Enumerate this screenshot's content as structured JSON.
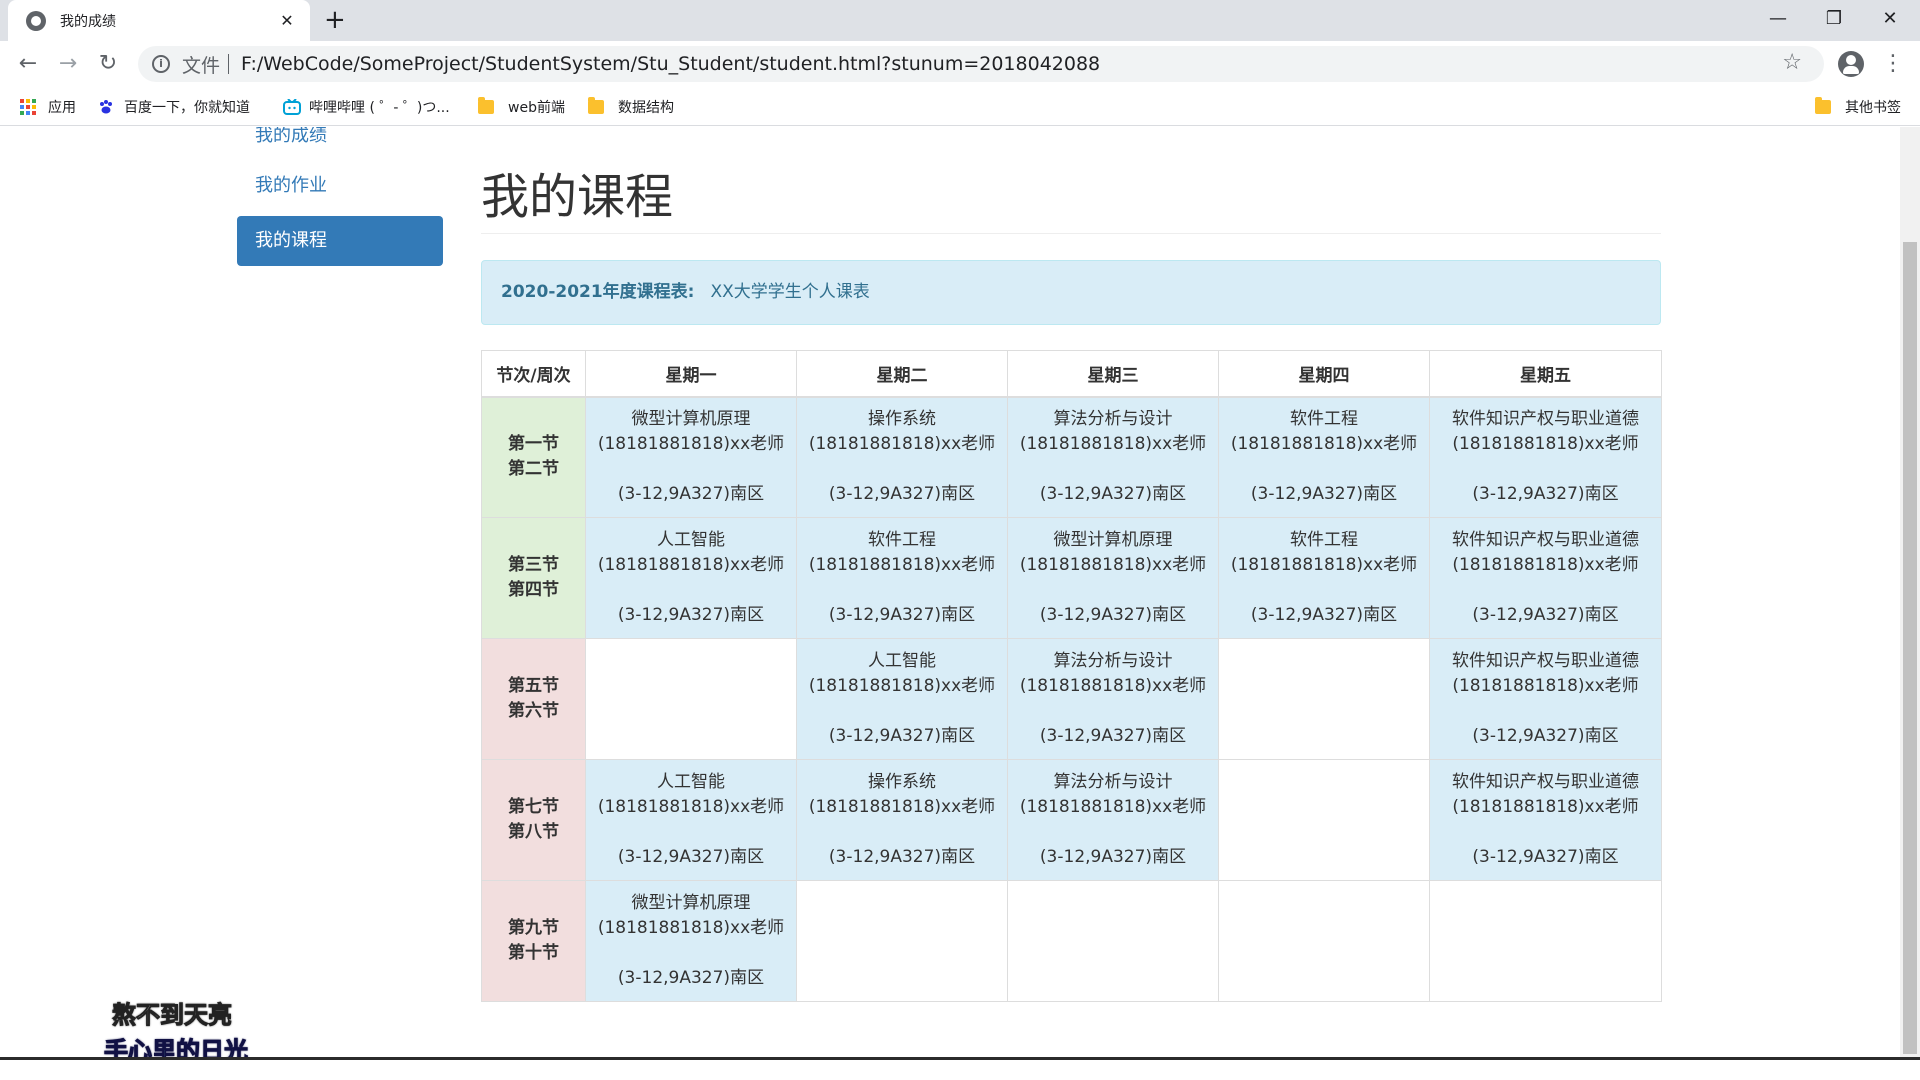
{
  "browser": {
    "tab_title": "我的成绩",
    "close_glyph": "✕",
    "new_tab_glyph": "+",
    "window_controls": {
      "minimize": "—",
      "maximize": "❐",
      "close": "✕"
    },
    "nav": {
      "back": "←",
      "forward": "→",
      "reload": "↻"
    },
    "address": {
      "info_glyph": "i",
      "scheme_label": "文件",
      "url": "F:/WebCode/SomeProject/StudentSystem/Stu_Student/student.html?stunum=2018042088"
    },
    "star_glyph": "☆",
    "menu_glyph": "⋮",
    "bookmarks": [
      {
        "label": "应用",
        "icon": "apps-grid-icon"
      },
      {
        "label": "百度一下，你就知道",
        "icon": "baidu-paw-icon"
      },
      {
        "label": "哔哩哔哩 ( ゜- ゜)つ...",
        "icon": "bilibili-tv-icon"
      },
      {
        "label": "web前端",
        "icon": "folder-icon"
      },
      {
        "label": "数据结构",
        "icon": "folder-icon"
      }
    ],
    "other_bookmarks": "其他书签"
  },
  "sidebar": {
    "items": [
      {
        "label": "我的成绩",
        "active": false
      },
      {
        "label": "我的作业",
        "active": false
      },
      {
        "label": "我的课程",
        "active": true
      }
    ]
  },
  "main": {
    "title": "我的课程",
    "alert": {
      "strong": "2020-2021年度课程表:",
      "text": "XX大学学生个人课表"
    },
    "schedule": {
      "headers": [
        "节次/周次",
        "星期一",
        "星期二",
        "星期三",
        "星期四",
        "星期五"
      ],
      "rows": [
        {
          "periods": [
            "第一节",
            "第二节"
          ],
          "tone": "g",
          "cells": [
            {
              "name": "微型计算机原理",
              "teacher": "(18181881818)xx老师",
              "location": "(3-12,9A327)南区"
            },
            {
              "name": "操作系统",
              "teacher": "(18181881818)xx老师",
              "location": "(3-12,9A327)南区"
            },
            {
              "name": "算法分析与设计",
              "teacher": "(18181881818)xx老师",
              "location": "(3-12,9A327)南区"
            },
            {
              "name": "软件工程",
              "teacher": "(18181881818)xx老师",
              "location": "(3-12,9A327)南区"
            },
            {
              "name": "软件知识产权与职业道德",
              "teacher": "(18181881818)xx老师",
              "location": "(3-12,9A327)南区"
            }
          ]
        },
        {
          "periods": [
            "第三节",
            "第四节"
          ],
          "tone": "g",
          "cells": [
            {
              "name": "人工智能",
              "teacher": "(18181881818)xx老师",
              "location": "(3-12,9A327)南区"
            },
            {
              "name": "软件工程",
              "teacher": "(18181881818)xx老师",
              "location": "(3-12,9A327)南区"
            },
            {
              "name": "微型计算机原理",
              "teacher": "(18181881818)xx老师",
              "location": "(3-12,9A327)南区"
            },
            {
              "name": "软件工程",
              "teacher": "(18181881818)xx老师",
              "location": "(3-12,9A327)南区"
            },
            {
              "name": "软件知识产权与职业道德",
              "teacher": "(18181881818)xx老师",
              "location": "(3-12,9A327)南区"
            }
          ]
        },
        {
          "periods": [
            "第五节",
            "第六节"
          ],
          "tone": "r",
          "cells": [
            null,
            {
              "name": "人工智能",
              "teacher": "(18181881818)xx老师",
              "location": "(3-12,9A327)南区"
            },
            {
              "name": "算法分析与设计",
              "teacher": "(18181881818)xx老师",
              "location": "(3-12,9A327)南区"
            },
            null,
            {
              "name": "软件知识产权与职业道德",
              "teacher": "(18181881818)xx老师",
              "location": "(3-12,9A327)南区"
            }
          ]
        },
        {
          "periods": [
            "第七节",
            "第八节"
          ],
          "tone": "r",
          "cells": [
            {
              "name": "人工智能",
              "teacher": "(18181881818)xx老师",
              "location": "(3-12,9A327)南区"
            },
            {
              "name": "操作系统",
              "teacher": "(18181881818)xx老师",
              "location": "(3-12,9A327)南区"
            },
            {
              "name": "算法分析与设计",
              "teacher": "(18181881818)xx老师",
              "location": "(3-12,9A327)南区"
            },
            null,
            {
              "name": "软件知识产权与职业道德",
              "teacher": "(18181881818)xx老师",
              "location": "(3-12,9A327)南区"
            }
          ]
        },
        {
          "periods": [
            "第九节",
            "第十节"
          ],
          "tone": "r",
          "cells": [
            {
              "name": "微型计算机原理",
              "teacher": "(18181881818)xx老师",
              "location": "(3-12,9A327)南区"
            },
            null,
            null,
            null,
            null
          ]
        }
      ]
    }
  },
  "overlay": {
    "line1": "熬不到天亮",
    "line2": "手心里的日光"
  },
  "colors": {
    "primary": "#337ab7",
    "info_bg": "#d9edf7",
    "info_text": "#31708f",
    "success_bg": "#dff0d8",
    "danger_bg": "#f2dede"
  }
}
